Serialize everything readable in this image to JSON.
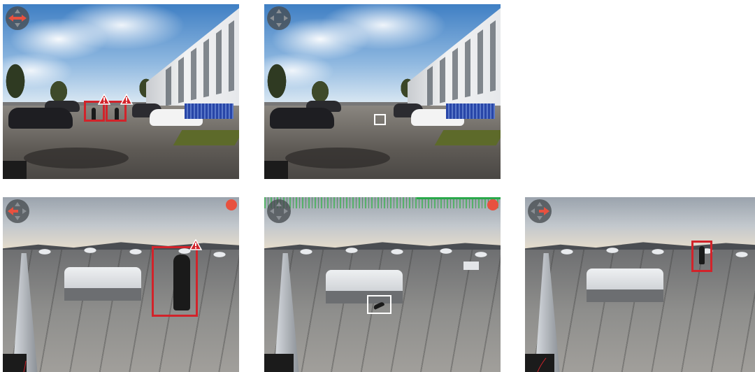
{
  "colors": {
    "alert": "#d2232a",
    "neutral_box": "#ffffff",
    "recording": "#e8513f",
    "ptz_active": "#e8513f",
    "ptz_idle": "#6b7075"
  },
  "tiles": [
    {
      "scene": "street",
      "ptz_icon": "ptz-pan-left-right-active",
      "recording": false,
      "alerts": 2,
      "minimap": true
    },
    {
      "scene": "street",
      "ptz_icon": "ptz-idle",
      "recording": false,
      "alerts": 0,
      "minimap": true
    },
    {
      "scene": "rooftop",
      "ptz_icon": "ptz-pan-left-active",
      "recording": true,
      "alerts": 1,
      "minimap": true
    },
    {
      "scene": "rooftop",
      "ptz_icon": "ptz-idle",
      "recording": true,
      "alerts": 0,
      "minimap": true,
      "signal_noise": true
    },
    {
      "scene": "rooftop",
      "ptz_icon": "ptz-pan-right-active",
      "recording": true,
      "alerts": 0,
      "minimap": true
    }
  ]
}
